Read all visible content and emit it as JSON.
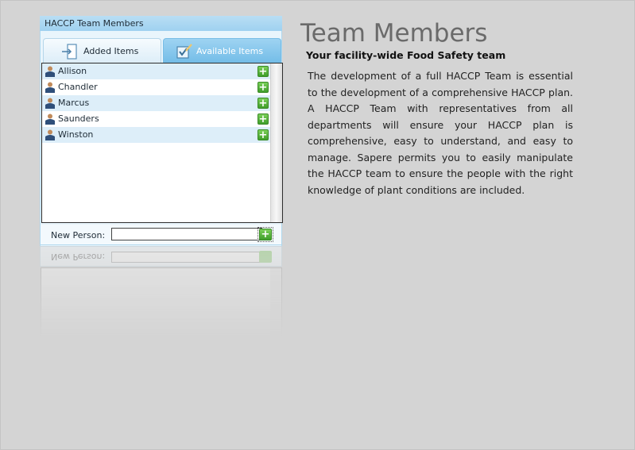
{
  "panel": {
    "header": "HACCP Team Members",
    "tabs": [
      {
        "label": "Added Items",
        "icon": "exit-door-icon",
        "active": true
      },
      {
        "label": "Available Items",
        "icon": "checkbox-edit-icon",
        "active": false
      }
    ],
    "members": [
      "Allison",
      "Chandler",
      "Marcus",
      "Saunders",
      "Winston"
    ],
    "new_person": {
      "label": "New Person:",
      "value": "",
      "add_button": "+"
    }
  },
  "reflection": {
    "label": "New Person:"
  },
  "content": {
    "title": "Team Members",
    "subtitle": "Your facility-wide Food Safety team",
    "description": "The development of a full HACCP Team is essential to the development of a comprehensive HACCP plan. A HACCP Team with representatives from all departments will ensure your HACCP plan is comprehensive, easy to understand, and easy to manage.  Sapere permits you to easily manipulate the HACCP team to ensure the people with the right knowledge of plant conditions are included."
  },
  "colors": {
    "background": "#d4d4d4",
    "header": "#a9d7f2",
    "active_tab": "#7fc2ea",
    "add_green": "#4caf35"
  }
}
